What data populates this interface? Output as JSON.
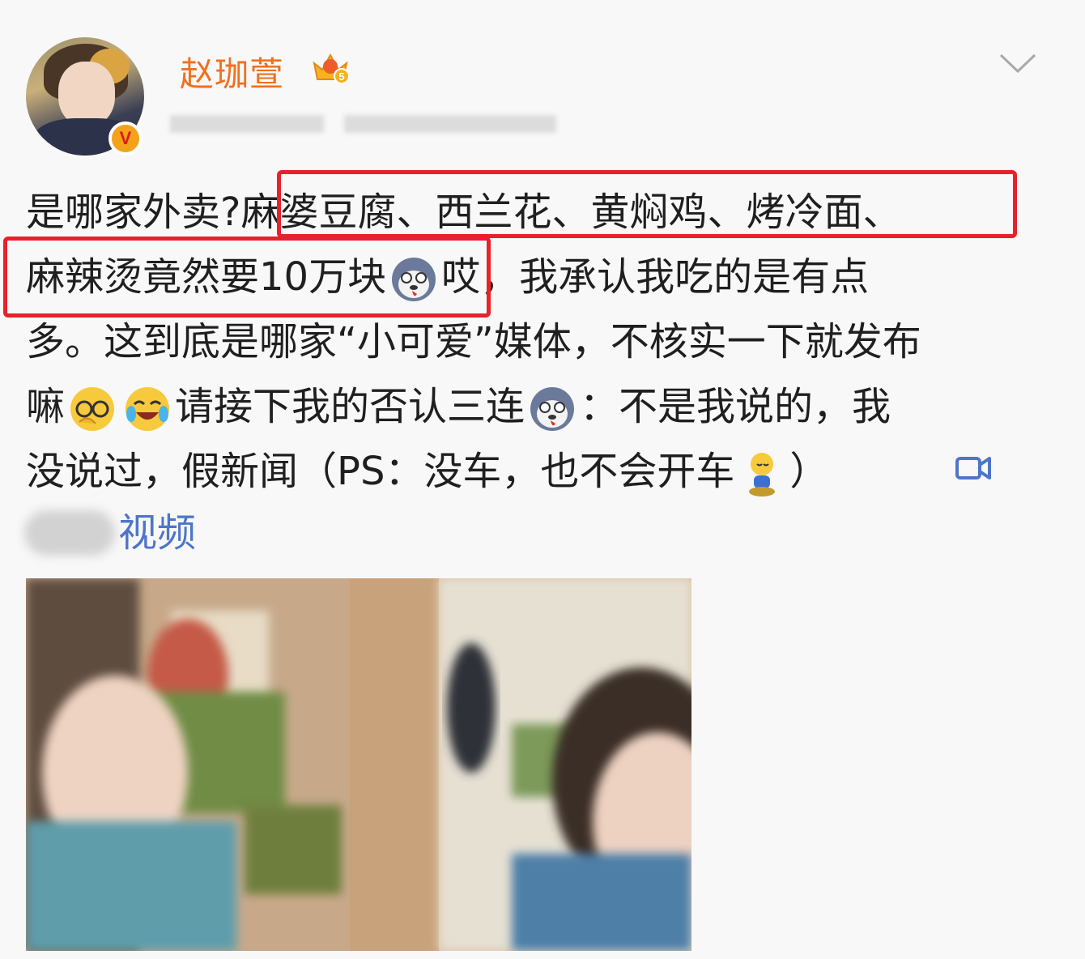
{
  "post": {
    "username": "赵珈萱",
    "verified_badge": "V",
    "vip_level": "5",
    "lines": {
      "line1_a": "是哪家外卖?",
      "line1_b": "麻婆豆腐、西兰花、黄焖鸡、烤冷面、",
      "line2_a": "麻辣烫竟然要10万块",
      "line2_b": "哎，我承认我吃的是有点",
      "line3": "多。这到底是哪家“小可爱”媒体，不核实一下就发布",
      "line4_a": "嘛",
      "line4_b": "请接下我的否认三连",
      "line4_c": "：不是我说的，我",
      "line5_a": "没说过，假新闻（PS：没车，也不会开车",
      "line5_b": "）",
      "line6": "视频"
    }
  },
  "colors": {
    "username": "#f0701d",
    "highlight_box": "#e8212b",
    "link": "#4e76c8",
    "body_text": "#1f1f1f"
  },
  "icons": [
    "crown-vip-icon",
    "chevron-down-icon",
    "husky-emoji-icon",
    "facepalm-glasses-emoji-icon",
    "laugh-cry-emoji-icon",
    "sitting-emoji-icon",
    "video-camera-icon"
  ]
}
